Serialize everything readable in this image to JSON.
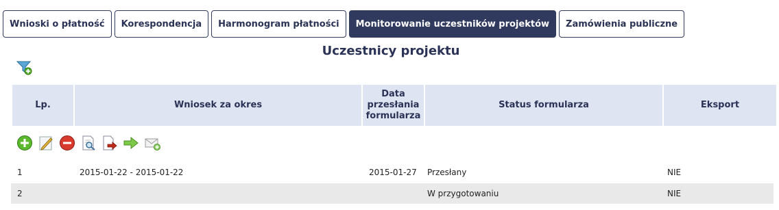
{
  "tabs": [
    {
      "label": "Wnioski o płatność",
      "active": false
    },
    {
      "label": "Korespondencja",
      "active": false
    },
    {
      "label": "Harmonogram płatności",
      "active": false
    },
    {
      "label": "Monitorowanie uczestników projektów",
      "active": true
    },
    {
      "label": "Zamówienia publiczne",
      "active": false
    }
  ],
  "page_title": "Uczestnicy projektu",
  "table": {
    "headers": {
      "lp": "Lp.",
      "wniosek": "Wniosek za okres",
      "data_line1": "Data",
      "data_line2": "przesłania",
      "data_line3": "formularza",
      "status": "Status formularza",
      "eksport": "Eksport"
    },
    "rows": [
      {
        "lp": "1",
        "wniosek": "2015-01-22 - 2015-01-22",
        "data": "2015-01-27",
        "status": "Przesłany",
        "eksport": "NIE"
      },
      {
        "lp": "2",
        "wniosek": "",
        "data": "",
        "status": "W przygotowaniu",
        "eksport": "NIE"
      }
    ]
  },
  "toolbar_icons": [
    "add-icon",
    "edit-icon",
    "delete-icon",
    "preview-icon",
    "export-document-icon",
    "send-arrow-icon",
    "mail-icon"
  ],
  "colors": {
    "tab_active": "#2f3a5e",
    "header_bg": "#dfe4f2",
    "accent_text": "#2a3356",
    "row_alt": "#e9e9e9"
  }
}
